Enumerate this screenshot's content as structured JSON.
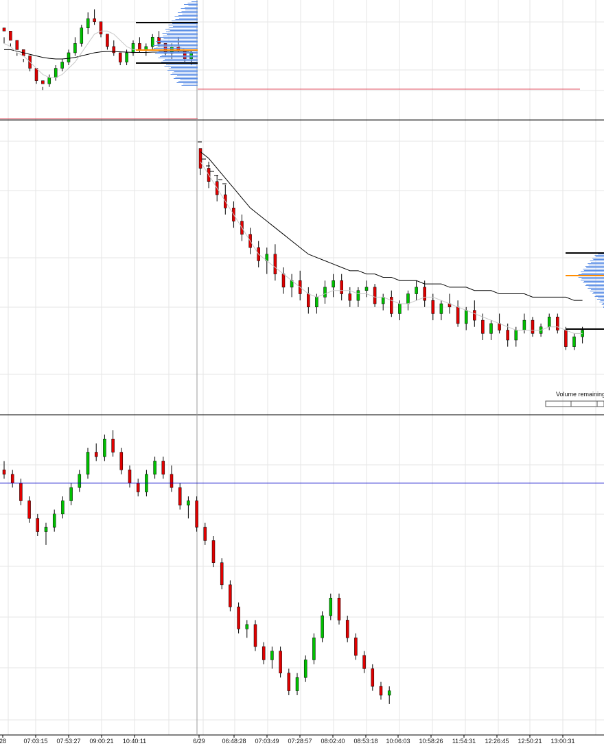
{
  "colors": {
    "background": "#ffffff",
    "grid": "#e6e6e6",
    "up_candle": "#00c000",
    "down_candle": "#e00000",
    "wick": "#000000",
    "vwap": "#000000",
    "ma": "#c8c8c8",
    "volume_profile": "#5b8ee6",
    "poc": "#ff8c00",
    "value_area_line": "#000000",
    "reference_line_red": "#e05060",
    "reference_line_blue": "#0000c8",
    "session_divider": "#999999"
  },
  "x_axis": {
    "ticks": [
      "28",
      "07:03:15",
      "07:53:27",
      "09:00:21",
      "10:40:11",
      "6/29",
      "06:48:28",
      "07:03:49",
      "07:28:57",
      "08:02:40",
      "08:53:18",
      "10:06:03",
      "10:58:26",
      "11:54:31",
      "12:26:45",
      "12:50:21",
      "13:00:31"
    ]
  },
  "session_break_label": "6/29",
  "volume_remaining_label": "Volume remaining",
  "chart_data": [
    {
      "type": "candlestick",
      "panel": "top",
      "series": [
        {
          "name": "",
          "kind": "candles",
          "values": [
            [
              65,
              62,
              60,
              64
            ],
            [
              64,
              60,
              59,
              61
            ],
            [
              61,
              57,
              56,
              58
            ],
            [
              58,
              55,
              54,
              56
            ],
            [
              56,
              53,
              51,
              52
            ],
            [
              52,
              49,
              47,
              48
            ],
            [
              48,
              46,
              45,
              47
            ],
            [
              47,
              50,
              46,
              49
            ],
            [
              49,
              53,
              48,
              52
            ],
            [
              52,
              55,
              51,
              54
            ],
            [
              54,
              58,
              53,
              57
            ],
            [
              57,
              62,
              56,
              60
            ],
            [
              60,
              66,
              59,
              65
            ],
            [
              65,
              70,
              63,
              68
            ],
            [
              68,
              71,
              66,
              67
            ],
            [
              67,
              64,
              62,
              63
            ],
            [
              63,
              60,
              58,
              59
            ],
            [
              59,
              61,
              56,
              57
            ],
            [
              57,
              55,
              53,
              54
            ],
            [
              54,
              58,
              53,
              57
            ],
            [
              57,
              61,
              56,
              60
            ],
            [
              60,
              62,
              57,
              58
            ],
            [
              58,
              60,
              56,
              59
            ],
            [
              59,
              63,
              58,
              62
            ],
            [
              62,
              64,
              59,
              60
            ],
            [
              60,
              58,
              56,
              57
            ],
            [
              57,
              60,
              55,
              59
            ],
            [
              59,
              62,
              57,
              58
            ],
            [
              58,
              56,
              54,
              55
            ],
            [
              55,
              58,
              53,
              57
            ]
          ]
        },
        {
          "name": "",
          "kind": "vwap",
          "values": [
            58,
            58,
            57.5,
            57,
            56.5,
            56,
            55.5,
            55.2,
            55,
            55,
            55.2,
            55.5,
            56,
            56.5,
            57,
            57.3,
            57.4,
            57.4,
            57.3,
            57.2,
            57.1,
            57.1,
            57.1,
            57.2,
            57.2,
            57.2,
            57.2,
            57.2,
            57.2,
            57.2
          ]
        },
        {
          "name": "",
          "kind": "ma",
          "values": [
            60,
            59,
            57,
            56,
            54,
            52,
            50,
            49,
            49,
            50,
            52,
            54,
            57,
            60,
            63,
            64,
            64,
            63,
            61,
            59,
            58,
            58,
            58,
            58,
            59,
            59,
            59,
            59,
            58,
            57
          ]
        }
      ]
    },
    {
      "type": "candlestick",
      "panel": "middle",
      "series": [
        {
          "name": "",
          "kind": "candles",
          "values": [
            [
              100,
              98,
              92,
              94
            ],
            [
              94,
              96,
              88,
              90
            ],
            [
              90,
              92,
              84,
              86
            ],
            [
              86,
              89,
              80,
              82
            ],
            [
              82,
              84,
              76,
              78
            ],
            [
              78,
              80,
              72,
              74
            ],
            [
              74,
              76,
              68,
              70
            ],
            [
              70,
              72,
              64,
              66
            ],
            [
              66,
              70,
              62,
              68
            ],
            [
              68,
              71,
              60,
              62
            ],
            [
              62,
              64,
              56,
              58
            ],
            [
              58,
              62,
              55,
              60
            ],
            [
              60,
              63,
              54,
              56
            ],
            [
              56,
              58,
              50,
              52
            ],
            [
              52,
              56,
              50,
              55
            ],
            [
              55,
              60,
              53,
              58
            ],
            [
              58,
              62,
              55,
              60
            ],
            [
              60,
              62,
              54,
              56
            ],
            [
              56,
              58,
              52,
              54
            ],
            [
              54,
              58,
              52,
              57
            ],
            [
              57,
              60,
              55,
              58
            ],
            [
              58,
              59,
              52,
              53
            ],
            [
              53,
              56,
              51,
              55
            ],
            [
              55,
              57,
              49,
              50
            ],
            [
              50,
              54,
              48,
              53
            ],
            [
              53,
              57,
              51,
              56
            ],
            [
              56,
              60,
              54,
              58
            ],
            [
              58,
              60,
              52,
              54
            ],
            [
              54,
              56,
              48,
              50
            ],
            [
              50,
              54,
              48,
              53
            ],
            [
              53,
              56,
              50,
              52
            ],
            [
              52,
              54,
              46,
              47
            ],
            [
              47,
              52,
              45,
              51
            ],
            [
              51,
              54,
              46,
              48
            ],
            [
              48,
              50,
              42,
              44
            ],
            [
              44,
              48,
              42,
              47
            ],
            [
              47,
              50,
              44,
              45
            ],
            [
              45,
              47,
              40,
              42
            ],
            [
              42,
              46,
              40,
              45
            ],
            [
              45,
              50,
              44,
              48
            ],
            [
              48,
              49,
              43,
              44
            ],
            [
              44,
              47,
              43,
              46
            ],
            [
              46,
              50,
              45,
              49
            ],
            [
              49,
              50,
              44,
              45
            ],
            [
              45,
              46,
              39,
              40
            ],
            [
              40,
              44,
              39,
              43
            ],
            [
              43,
              46,
              41,
              45
            ]
          ]
        },
        {
          "name": "",
          "kind": "vwap",
          "values": [
            99,
            97,
            94,
            91,
            88,
            85,
            82,
            80,
            78,
            76,
            74,
            72,
            70,
            68,
            67,
            66,
            65,
            64,
            63,
            63,
            62,
            62,
            61,
            61,
            60,
            60,
            60,
            59,
            59,
            59,
            58,
            58,
            58,
            57,
            57,
            57,
            56,
            56,
            56,
            56,
            55,
            55,
            55,
            55,
            55,
            54,
            54
          ]
        },
        {
          "name": "",
          "kind": "ma",
          "values": [
            96,
            92,
            88,
            84,
            80,
            76,
            72,
            68,
            66,
            64,
            62,
            60,
            58,
            56,
            55,
            56,
            57,
            57,
            57,
            56,
            56,
            55,
            55,
            54,
            53,
            53,
            54,
            55,
            55,
            54,
            53,
            52,
            51,
            50,
            49,
            48,
            47,
            46,
            45,
            45,
            45,
            45,
            46,
            46,
            45,
            44,
            44
          ]
        }
      ]
    },
    {
      "type": "candlestick",
      "panel": "bottom",
      "series": [
        {
          "name": "",
          "kind": "candles",
          "values": [
            [
              70,
              72,
              68,
              69
            ],
            [
              69,
              70,
              66,
              67
            ],
            [
              67,
              68,
              62,
              63
            ],
            [
              63,
              64,
              58,
              59
            ],
            [
              59,
              60,
              55,
              56
            ],
            [
              56,
              58,
              53,
              57
            ],
            [
              57,
              61,
              56,
              60
            ],
            [
              60,
              64,
              59,
              63
            ],
            [
              63,
              67,
              62,
              66
            ],
            [
              66,
              70,
              65,
              69
            ],
            [
              69,
              75,
              68,
              74
            ],
            [
              74,
              76,
              72,
              73
            ],
            [
              73,
              78,
              72,
              77
            ],
            [
              77,
              79,
              73,
              74
            ],
            [
              74,
              75,
              69,
              70
            ],
            [
              70,
              71,
              66,
              67
            ],
            [
              67,
              68,
              64,
              65
            ],
            [
              65,
              70,
              64,
              69
            ],
            [
              69,
              73,
              68,
              72
            ],
            [
              72,
              73,
              68,
              69
            ],
            [
              69,
              71,
              65,
              66
            ],
            [
              66,
              67,
              61,
              62
            ],
            [
              62,
              64,
              59,
              63
            ],
            [
              63,
              64,
              56,
              57
            ],
            [
              57,
              58,
              53,
              54
            ],
            [
              54,
              55,
              48,
              49
            ],
            [
              49,
              50,
              43,
              44
            ],
            [
              44,
              45,
              38,
              39
            ],
            [
              39,
              40,
              33,
              34
            ],
            [
              34,
              36,
              32,
              35
            ],
            [
              35,
              36,
              29,
              30
            ],
            [
              30,
              31,
              26,
              27
            ],
            [
              27,
              30,
              25,
              29
            ],
            [
              29,
              30,
              23,
              24
            ],
            [
              24,
              25,
              19,
              20
            ],
            [
              20,
              24,
              19,
              23
            ],
            [
              23,
              28,
              22,
              27
            ],
            [
              27,
              33,
              26,
              32
            ],
            [
              32,
              38,
              31,
              37
            ],
            [
              37,
              42,
              36,
              41
            ],
            [
              41,
              42,
              35,
              36
            ],
            [
              36,
              37,
              31,
              32
            ],
            [
              32,
              33,
              27,
              28
            ],
            [
              28,
              29,
              24,
              25
            ],
            [
              25,
              26,
              20,
              21
            ],
            [
              21,
              22,
              18,
              19
            ],
            [
              19,
              21,
              17,
              20
            ]
          ]
        },
        {
          "name": "",
          "kind": "hline",
          "values": [
            67
          ]
        }
      ]
    }
  ]
}
